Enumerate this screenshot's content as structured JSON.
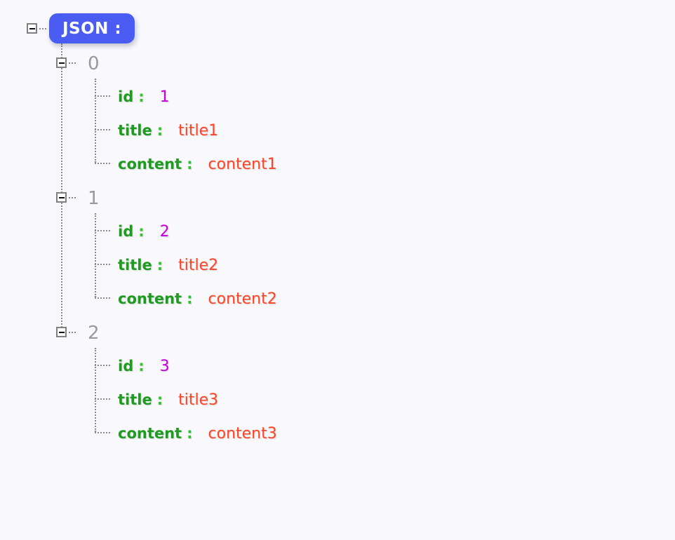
{
  "viewer": {
    "background_color": "#f8f8fd",
    "root": {
      "label": "JSON :",
      "badge_color": "#4a5cf2",
      "badge_text_color": "#ffffff",
      "toggle_icon": "minus-square-icon",
      "expanded": true
    },
    "colors": {
      "key": "#1f9c1f",
      "colon": "#2fc32f",
      "number_value": "#c800e0",
      "string_value": "#ff4422",
      "index_label": "#9a9a9a",
      "tree_line": "#8a8a8a",
      "toggle_border": "#808080"
    },
    "items": [
      {
        "index": "0",
        "toggle_icon": "minus-square-icon",
        "expanded": true,
        "fields": [
          {
            "key": "id",
            "colon": ":",
            "value": "1",
            "type": "num"
          },
          {
            "key": "title",
            "colon": ":",
            "value": "title1",
            "type": "str"
          },
          {
            "key": "content",
            "colon": ":",
            "value": "content1",
            "type": "str"
          }
        ]
      },
      {
        "index": "1",
        "toggle_icon": "minus-square-icon",
        "expanded": true,
        "fields": [
          {
            "key": "id",
            "colon": ":",
            "value": "2",
            "type": "num"
          },
          {
            "key": "title",
            "colon": ":",
            "value": "title2",
            "type": "str"
          },
          {
            "key": "content",
            "colon": ":",
            "value": "content2",
            "type": "str"
          }
        ]
      },
      {
        "index": "2",
        "toggle_icon": "minus-square-icon",
        "expanded": true,
        "fields": [
          {
            "key": "id",
            "colon": ":",
            "value": "3",
            "type": "num"
          },
          {
            "key": "title",
            "colon": ":",
            "value": "title3",
            "type": "str"
          },
          {
            "key": "content",
            "colon": ":",
            "value": "content3",
            "type": "str"
          }
        ]
      }
    ]
  }
}
